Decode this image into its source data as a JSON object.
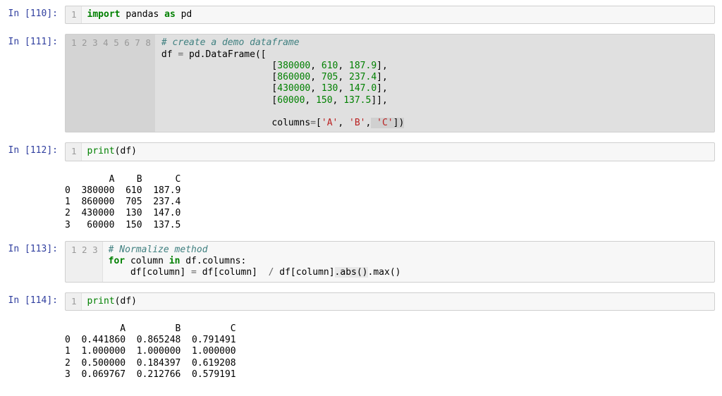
{
  "cells": [
    {
      "prompt": "In [110]:",
      "type": "code",
      "active": false,
      "lines": [
        "1"
      ],
      "html": "<span class='kw'>import</span> <span class='nm'>pandas</span> <span class='kw'>as</span> <span class='nm'>pd</span>"
    },
    {
      "prompt": "In [111]:",
      "type": "code",
      "active": true,
      "lines": [
        "1",
        "2",
        "3",
        "4",
        "5",
        "6",
        "7",
        "8"
      ],
      "html": "<span class='cmt'># create a demo dataframe</span>\ndf <span class='op'>=</span> pd.DataFrame([\n                    [<span class='num'>380000</span>, <span class='num'>610</span>, <span class='num'>187.9</span>],\n                    [<span class='num'>860000</span>, <span class='num'>705</span>, <span class='num'>237.4</span>],\n                    [<span class='num'>430000</span>, <span class='num'>130</span>, <span class='num'>147.0</span>],\n                    [<span class='num'>60000</span>, <span class='num'>150</span>, <span class='num'>137.5</span>]],\n\n                    columns<span class='op'>=</span>[<span class='str'>'A'</span>, <span class='str'>'B'</span>,<span class='hlg'> <span class='str'>'C'</span>])</span>"
    },
    {
      "prompt": "In [112]:",
      "type": "code",
      "active": false,
      "lines": [
        "1"
      ],
      "html": "<span class='bi'>print</span>(df)"
    },
    {
      "prompt": "",
      "type": "output",
      "text": "        A    B      C\n0  380000  610  187.9\n1  860000  705  237.4\n2  430000  130  147.0\n3   60000  150  137.5"
    },
    {
      "prompt": "In [113]:",
      "type": "code",
      "active": false,
      "lines": [
        "1",
        "2",
        "3"
      ],
      "html": "<span class='cmt'># Normalize method</span>\n<span class='kw'>for</span> column <span class='kw'>in</span> df.columns:\n    df[column] <span class='op'>=</span> df[column]  <span class='op'>/</span> df[column]<span class='hl'>.abs()</span>.max()"
    },
    {
      "prompt": "In [114]:",
      "type": "code",
      "active": false,
      "lines": [
        "1"
      ],
      "html": "<span class='bi'>print</span>(df)"
    },
    {
      "prompt": "",
      "type": "output",
      "text": "          A         B         C\n0  0.441860  0.865248  0.791491\n1  1.000000  1.000000  1.000000\n2  0.500000  0.184397  0.619208\n3  0.069767  0.212766  0.579191"
    }
  ],
  "chart_data": {
    "type": "table",
    "title": "Demo DataFrame (raw and normalized)",
    "raw": {
      "columns": [
        "A",
        "B",
        "C"
      ],
      "index": [
        0,
        1,
        2,
        3
      ],
      "data": [
        [
          380000,
          610,
          187.9
        ],
        [
          860000,
          705,
          237.4
        ],
        [
          430000,
          130,
          147.0
        ],
        [
          60000,
          150,
          137.5
        ]
      ]
    },
    "normalized": {
      "columns": [
        "A",
        "B",
        "C"
      ],
      "index": [
        0,
        1,
        2,
        3
      ],
      "data": [
        [
          0.44186,
          0.865248,
          0.791491
        ],
        [
          1.0,
          1.0,
          1.0
        ],
        [
          0.5,
          0.184397,
          0.619208
        ],
        [
          0.069767,
          0.212766,
          0.579191
        ]
      ]
    }
  }
}
